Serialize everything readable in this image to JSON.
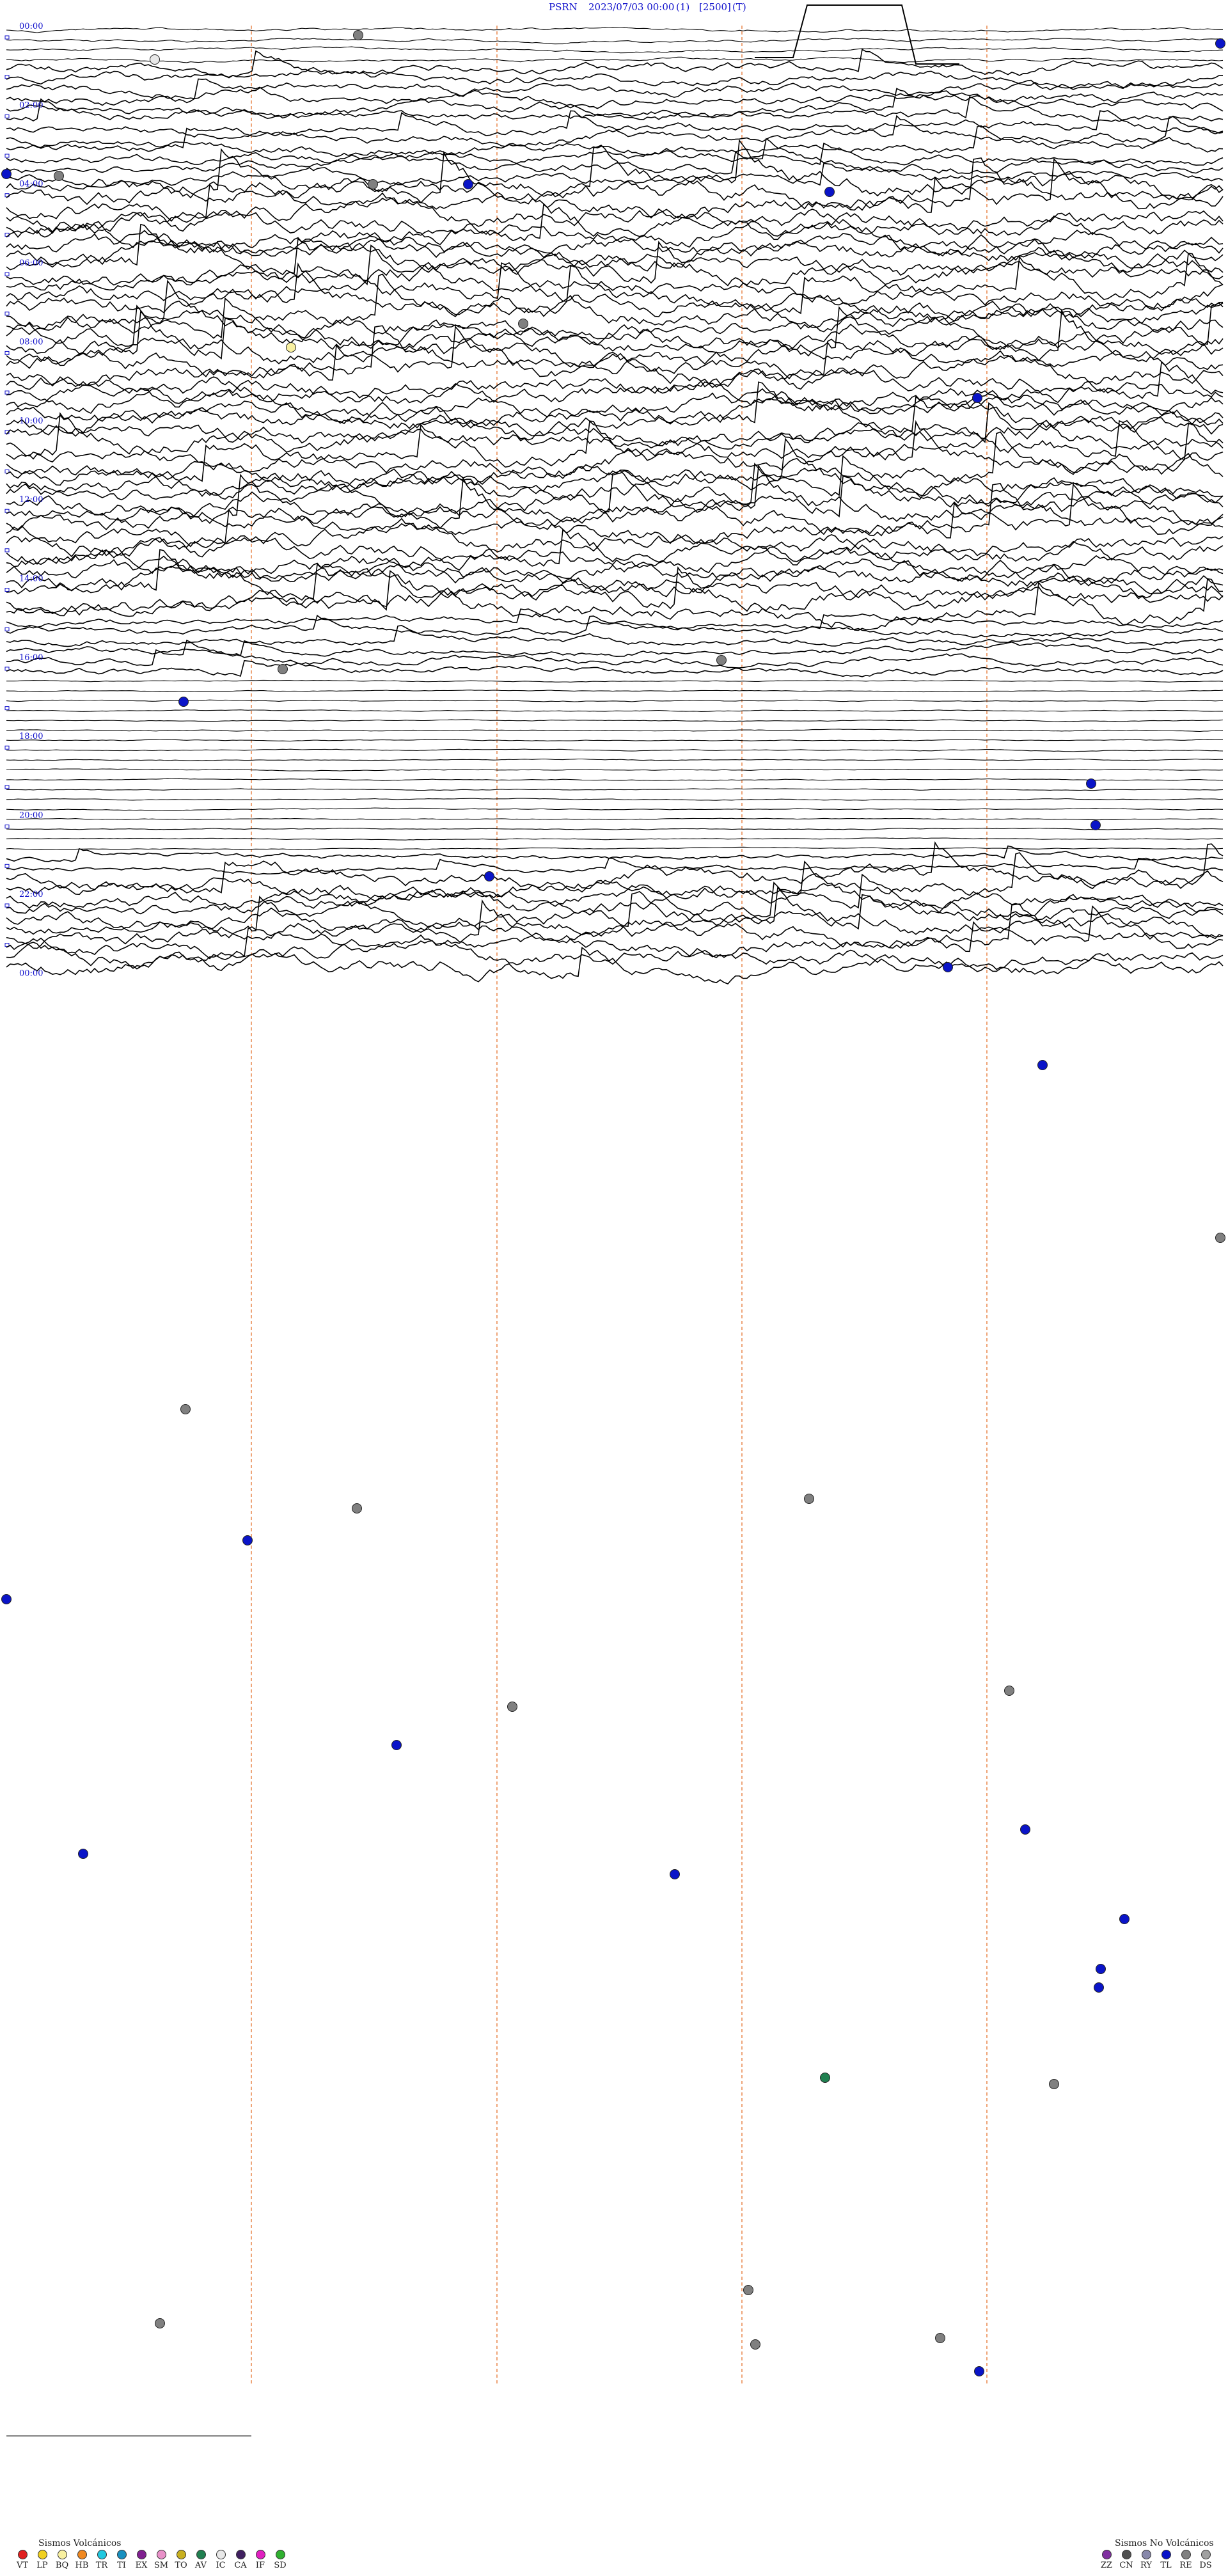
{
  "header": {
    "station": "PSRN",
    "datetime": "2023/07/03 00:00",
    "channel": "(1)",
    "scale": "[2500]",
    "mode": "(T)"
  },
  "time_labels": [
    "00:00",
    "02:00",
    "04:00",
    "06:00",
    "08:00",
    "10:00",
    "12:00",
    "14:00",
    "16:00",
    "18:00",
    "20:00",
    "22:00",
    "00:00"
  ],
  "colors": {
    "text": "#1111cc",
    "trace": "#000000",
    "minute_grid": "#e8864a",
    "VT": "#e02020",
    "LP": "#f0d020",
    "BQ": "#f8f0a0",
    "HB": "#f08820",
    "TR": "#20c8e0",
    "TI": "#1890c0",
    "EX": "#802090",
    "SM": "#e890c8",
    "TO": "#c8b020",
    "AV": "#208050",
    "IC": "#e8e8e8",
    "CA": "#402060",
    "IF": "#e020c0",
    "SD": "#30b030",
    "ZZ": "#8030a0",
    "CN": "#505050",
    "RY": "#8888aa",
    "TL": "#0a14c8",
    "RE": "#808080",
    "DS": "#a0a0a0"
  },
  "legend_volcanic": {
    "title": "Sismos Volcánicos",
    "items": [
      "VT",
      "LP",
      "BQ",
      "HB",
      "TR",
      "TI",
      "EX",
      "SM",
      "TO",
      "AV",
      "IC",
      "CA",
      "IF",
      "SD"
    ]
  },
  "legend_nonvolcanic": {
    "title": "Sismos No Volcánicos",
    "items": [
      "ZZ",
      "CN",
      "RY",
      "TL",
      "RE",
      "DS"
    ]
  }
}
